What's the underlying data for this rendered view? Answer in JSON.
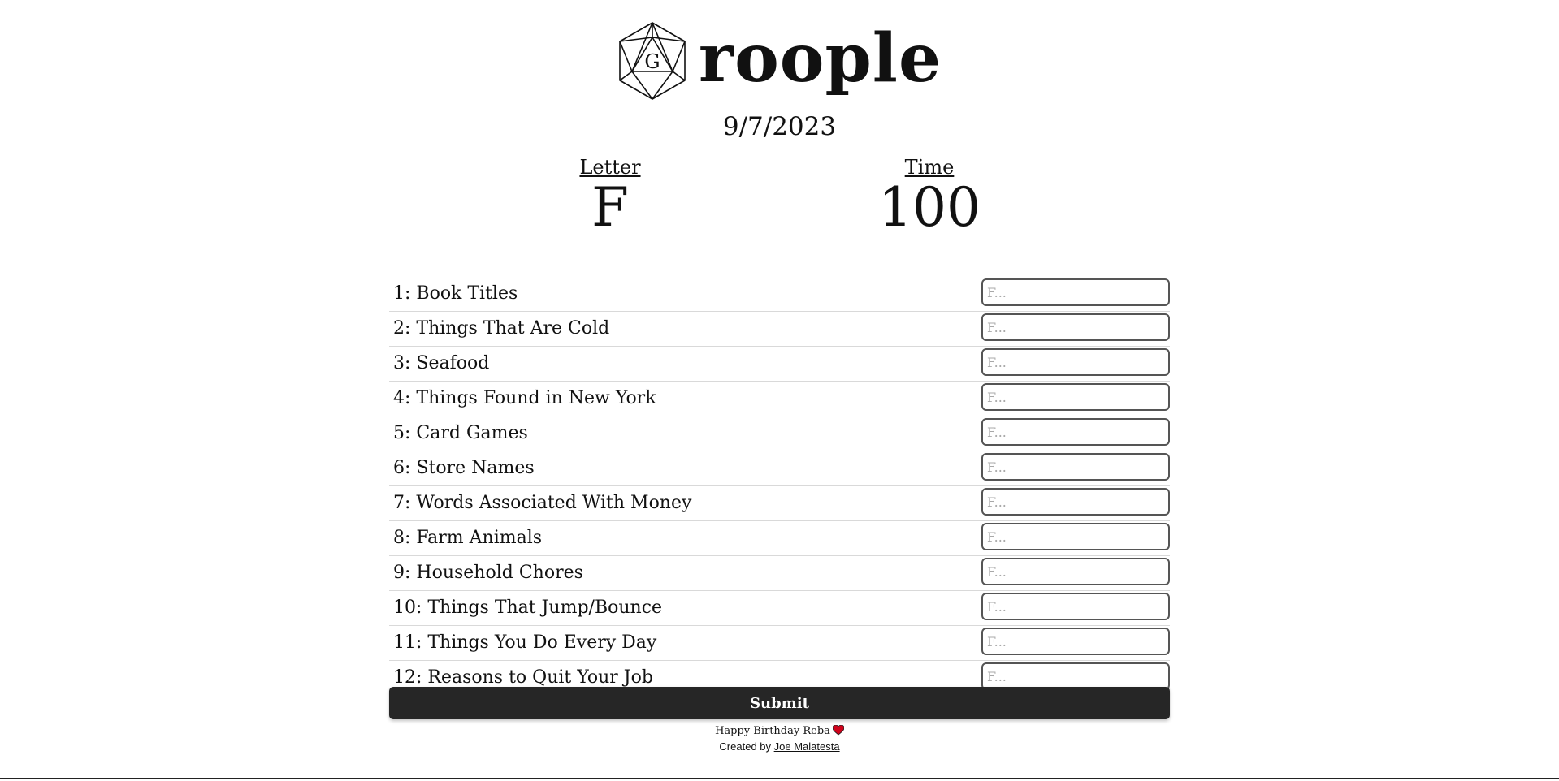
{
  "brand": {
    "logo_letter": "G",
    "title": "roople"
  },
  "date": "9/7/2023",
  "stats": {
    "letter_label": "Letter",
    "letter_value": "F",
    "time_label": "Time",
    "time_value": "100"
  },
  "categories": [
    {
      "label": "1: Book Titles",
      "placeholder": "F..."
    },
    {
      "label": "2: Things That Are Cold",
      "placeholder": "F..."
    },
    {
      "label": "3: Seafood",
      "placeholder": "F..."
    },
    {
      "label": "4: Things Found in New York",
      "placeholder": "F..."
    },
    {
      "label": "5: Card Games",
      "placeholder": "F..."
    },
    {
      "label": "6: Store Names",
      "placeholder": "F..."
    },
    {
      "label": "7: Words Associated With Money",
      "placeholder": "F..."
    },
    {
      "label": "8: Farm Animals",
      "placeholder": "F..."
    },
    {
      "label": "9: Household Chores",
      "placeholder": "F..."
    },
    {
      "label": "10: Things That Jump/Bounce",
      "placeholder": "F..."
    },
    {
      "label": "11: Things You Do Every Day",
      "placeholder": "F..."
    },
    {
      "label": "12: Reasons to Quit Your Job",
      "placeholder": "F..."
    }
  ],
  "submit_label": "Submit",
  "footer": {
    "dedication": "Happy Birthday Reba",
    "created_by": "Created by",
    "author_link": "Joe Malatesta",
    "heart_color": "#d0021b"
  }
}
